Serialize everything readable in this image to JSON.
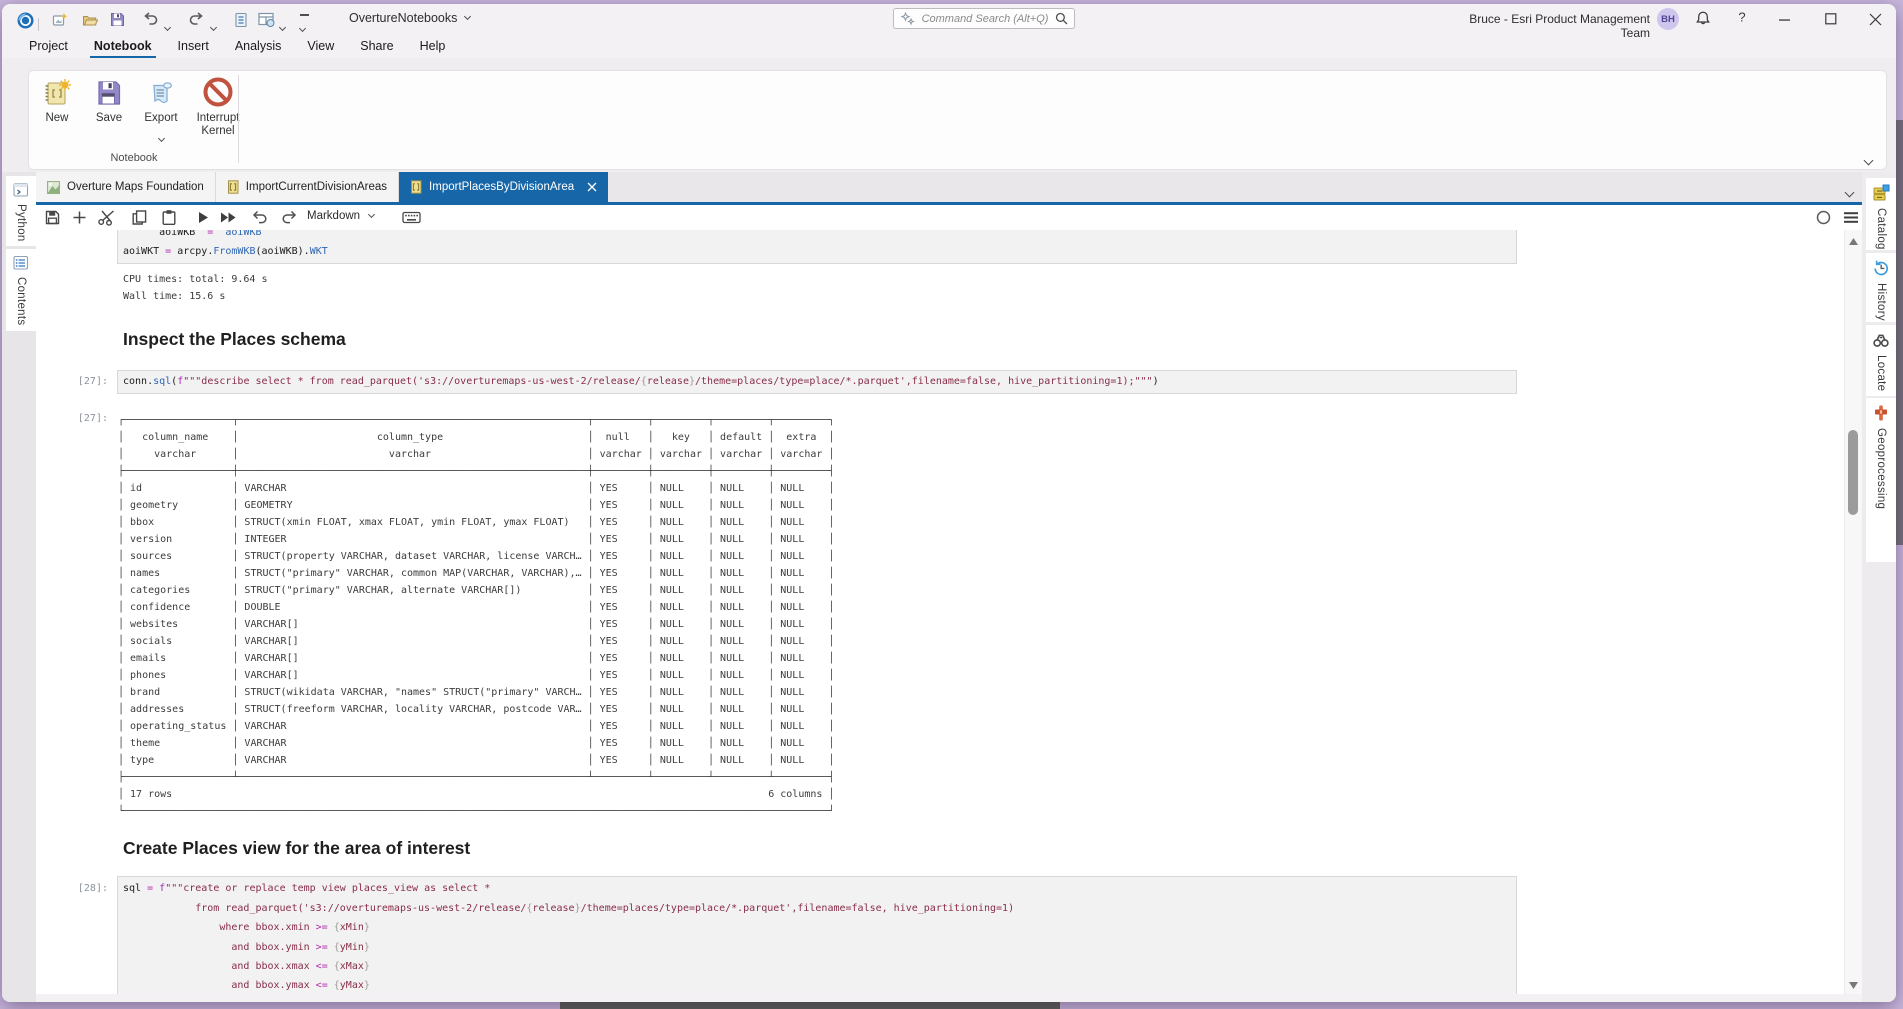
{
  "app": {
    "desktop_color": "#c9b7dd",
    "accent_blue": "#1766a8"
  },
  "titlebar": {
    "project_title": "OvertureNotebooks",
    "qat_icons": [
      "app-logo",
      "new-project",
      "open-project",
      "save-project",
      "undo",
      "redo",
      "add-data",
      "windows",
      "customize-qat"
    ],
    "search_placeholder": "Command Search (Alt+Q)",
    "user_name": "Bruce - Esri Product Management Team",
    "user_initials": "BH",
    "window_controls": [
      "notifications",
      "help",
      "minimize",
      "maximize",
      "close"
    ]
  },
  "menubar": {
    "items": [
      "Project",
      "Notebook",
      "Insert",
      "Analysis",
      "View",
      "Share",
      "Help"
    ],
    "active_index": 1
  },
  "ribbon": {
    "buttons": [
      {
        "label": "New",
        "icon": "new-notebook",
        "has_dropdown": false
      },
      {
        "label": "Save",
        "icon": "save-notebook",
        "has_dropdown": false
      },
      {
        "label": "Export",
        "icon": "export-notebook",
        "has_dropdown": true
      },
      {
        "label": "Interrupt Kernel",
        "icon": "interrupt-kernel",
        "has_dropdown": false
      }
    ],
    "group_label": "Notebook"
  },
  "doc_tabs": [
    {
      "label": "Overture Maps Foundation",
      "icon": "map-doc",
      "active": false,
      "closable": false
    },
    {
      "label": "ImportCurrentDivisionAreas",
      "icon": "notebook-doc",
      "active": false,
      "closable": false
    },
    {
      "label": "ImportPlacesByDivisionArea",
      "icon": "notebook-doc",
      "active": true,
      "closable": true
    }
  ],
  "nb_toolbar": {
    "icons": [
      "save",
      "add-cell",
      "cut-cell",
      "copy-cell",
      "paste-cell",
      "run-cell",
      "run-all",
      "undo",
      "redo"
    ],
    "cell_type": "Markdown",
    "right_icons": [
      "kernel-status",
      "toolbar-menu"
    ]
  },
  "left_panel": [
    {
      "label": "Python",
      "icon": "python-console"
    },
    {
      "label": "Contents",
      "icon": "contents-list"
    }
  ],
  "right_panel": [
    {
      "label": "Catalog",
      "icon": "catalog"
    },
    {
      "label": "History",
      "icon": "history"
    },
    {
      "label": "Locate",
      "icon": "locate"
    },
    {
      "label": "Geoprocessing",
      "icon": "geoprocessing"
    }
  ],
  "notebook": {
    "cells": [
      {
        "kind": "code",
        "prompt": "",
        "lines": [
          [
            [
              "ws",
              "      "
            ],
            [
              "pl",
              "aoiWKB"
            ],
            [
              "ws",
              "  "
            ],
            [
              "op",
              "="
            ],
            [
              "ws",
              "  "
            ],
            [
              "meth",
              "aoiWKB"
            ]
          ],
          [
            [
              "pl",
              "aoiWKT"
            ],
            [
              "ws",
              " "
            ],
            [
              "op",
              "="
            ],
            [
              "ws",
              " "
            ],
            [
              "pl",
              "arcpy."
            ],
            [
              "meth",
              "FromWKB"
            ],
            [
              "pl",
              "(aoiWKB)."
            ],
            [
              "meth",
              "WKT"
            ]
          ]
        ]
      },
      {
        "kind": "output",
        "lines": [
          "CPU times: total: 9.64 s",
          "Wall time: 15.6 s"
        ]
      },
      {
        "kind": "heading",
        "text": "Inspect the Places schema"
      },
      {
        "kind": "code",
        "prompt": "[27]:",
        "lines": [
          [
            [
              "pl",
              "conn."
            ],
            [
              "meth",
              "sql"
            ],
            [
              "pl",
              "("
            ],
            [
              "f",
              "f"
            ],
            [
              "str",
              "\"\"\"describe select * from read_parquet('s3://overturemaps-us-west-2/release/"
            ],
            [
              "br",
              "{"
            ],
            [
              "str",
              "release"
            ],
            [
              "br",
              "}"
            ],
            [
              "str",
              "/theme=places/type=place/*.parquet',filename=false, hive_partitioning=1);\"\"\""
            ],
            [
              "pl",
              ")"
            ]
          ]
        ]
      },
      {
        "kind": "table",
        "prompt": "[27]:"
      },
      {
        "kind": "heading",
        "text": "Create Places view for the area of interest"
      },
      {
        "kind": "code",
        "prompt": "[28]:",
        "lines": [
          [
            [
              "pl",
              "sql "
            ],
            [
              "op",
              "="
            ],
            [
              "ws",
              " "
            ],
            [
              "f",
              "f"
            ],
            [
              "str",
              "\"\"\"create or replace temp view places_view as select *"
            ]
          ],
          [
            [
              "ws",
              "            "
            ],
            [
              "str",
              "from read_parquet('s3://overturemaps-us-west-2/release/"
            ],
            [
              "br",
              "{"
            ],
            [
              "str",
              "release"
            ],
            [
              "br",
              "}"
            ],
            [
              "str",
              "/theme=places/type=place/*.parquet',filename=false, hive_partitioning=1)"
            ]
          ],
          [
            [
              "ws",
              "                "
            ],
            [
              "str",
              "where bbox.xmin "
            ],
            [
              "op",
              ">="
            ],
            [
              "ws",
              " "
            ],
            [
              "br",
              "{"
            ],
            [
              "str",
              "xMin"
            ],
            [
              "br",
              "}"
            ]
          ],
          [
            [
              "ws",
              "                  "
            ],
            [
              "str",
              "and bbox.ymin "
            ],
            [
              "op",
              ">="
            ],
            [
              "ws",
              " "
            ],
            [
              "br",
              "{"
            ],
            [
              "str",
              "yMin"
            ],
            [
              "br",
              "}"
            ]
          ],
          [
            [
              "ws",
              "                  "
            ],
            [
              "str",
              "and bbox.xmax "
            ],
            [
              "op",
              "<="
            ],
            [
              "ws",
              " "
            ],
            [
              "br",
              "{"
            ],
            [
              "str",
              "xMax"
            ],
            [
              "br",
              "}"
            ]
          ],
          [
            [
              "ws",
              "                  "
            ],
            [
              "str",
              "and bbox.ymax "
            ],
            [
              "op",
              "<="
            ],
            [
              "ws",
              " "
            ],
            [
              "br",
              "{"
            ],
            [
              "str",
              "yMax"
            ],
            [
              "br",
              "}"
            ]
          ]
        ]
      }
    ],
    "schema_table": {
      "columns": [
        {
          "name": "column_name",
          "type": "varchar",
          "width": 18
        },
        {
          "name": "column_type",
          "type": "varchar",
          "width": 58
        },
        {
          "name": "null",
          "type": "varchar",
          "width": 9
        },
        {
          "name": "key",
          "type": "varchar",
          "width": 9
        },
        {
          "name": "default",
          "type": "varchar",
          "width": 9
        },
        {
          "name": "extra",
          "type": "varchar",
          "width": 9
        }
      ],
      "rows": [
        [
          "id",
          "VARCHAR",
          "YES",
          "NULL",
          "NULL",
          "NULL"
        ],
        [
          "geometry",
          "GEOMETRY",
          "YES",
          "NULL",
          "NULL",
          "NULL"
        ],
        [
          "bbox",
          "STRUCT(xmin FLOAT, xmax FLOAT, ymin FLOAT, ymax FLOAT)",
          "YES",
          "NULL",
          "NULL",
          "NULL"
        ],
        [
          "version",
          "INTEGER",
          "YES",
          "NULL",
          "NULL",
          "NULL"
        ],
        [
          "sources",
          "STRUCT(property VARCHAR, dataset VARCHAR, license VARCH…",
          "YES",
          "NULL",
          "NULL",
          "NULL"
        ],
        [
          "names",
          "STRUCT(\"primary\" VARCHAR, common MAP(VARCHAR, VARCHAR),…",
          "YES",
          "NULL",
          "NULL",
          "NULL"
        ],
        [
          "categories",
          "STRUCT(\"primary\" VARCHAR, alternate VARCHAR[])",
          "YES",
          "NULL",
          "NULL",
          "NULL"
        ],
        [
          "confidence",
          "DOUBLE",
          "YES",
          "NULL",
          "NULL",
          "NULL"
        ],
        [
          "websites",
          "VARCHAR[]",
          "YES",
          "NULL",
          "NULL",
          "NULL"
        ],
        [
          "socials",
          "VARCHAR[]",
          "YES",
          "NULL",
          "NULL",
          "NULL"
        ],
        [
          "emails",
          "VARCHAR[]",
          "YES",
          "NULL",
          "NULL",
          "NULL"
        ],
        [
          "phones",
          "VARCHAR[]",
          "YES",
          "NULL",
          "NULL",
          "NULL"
        ],
        [
          "brand",
          "STRUCT(wikidata VARCHAR, \"names\" STRUCT(\"primary\" VARCH…",
          "YES",
          "NULL",
          "NULL",
          "NULL"
        ],
        [
          "addresses",
          "STRUCT(freeform VARCHAR, locality VARCHAR, postcode VAR…",
          "YES",
          "NULL",
          "NULL",
          "NULL"
        ],
        [
          "operating_status",
          "VARCHAR",
          "YES",
          "NULL",
          "NULL",
          "NULL"
        ],
        [
          "theme",
          "VARCHAR",
          "YES",
          "NULL",
          "NULL",
          "NULL"
        ],
        [
          "type",
          "VARCHAR",
          "YES",
          "NULL",
          "NULL",
          "NULL"
        ]
      ],
      "footer_left": "17 rows",
      "footer_right": "6 columns"
    }
  }
}
